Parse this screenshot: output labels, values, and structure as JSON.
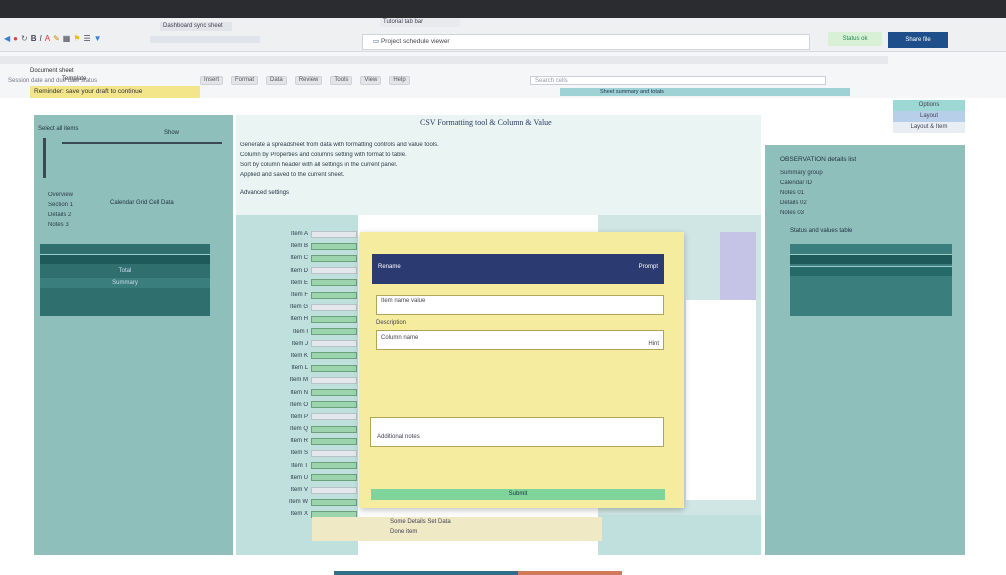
{
  "window": {
    "title": "Tutorial tab bar"
  },
  "toolbar": {
    "url_text": "Dashboard sync sheet",
    "center_text": "Project schedule viewer",
    "status_chip": "Status ok",
    "share_button": "Share file",
    "icons": [
      "back-icon",
      "forward-icon",
      "refresh-icon",
      "bold-icon",
      "italic-icon",
      "text-color-icon",
      "paint-icon",
      "table-icon",
      "link-icon",
      "comment-icon",
      "filter-icon"
    ]
  },
  "ribbon": {
    "left_labels": [
      "Document sheet",
      "Template"
    ],
    "row_text": "Session date and due date status",
    "tabs": [
      "Insert",
      "Format",
      "Data",
      "Review",
      "Tools",
      "View",
      "Help"
    ],
    "search_placeholder": "Search cells",
    "summary_text": "Sheet summary and totals"
  },
  "yellow_bar": {
    "text": "Reminder: save your draft to continue"
  },
  "top_right_menu": [
    "Options",
    "Layout",
    "Layout & Item"
  ],
  "left_panel": {
    "header": "Select all items",
    "sub_header": "Show",
    "items": [
      "Overview",
      "Section 1",
      "Details 2",
      "Notes 3"
    ],
    "details_text": "Calendar Grid Cell Data",
    "chart_labels": [
      "Total",
      "Summary"
    ]
  },
  "main": {
    "title": "CSV Formatting tool & Column & Value",
    "intro_lines": [
      "Generate a spreadsheet from data with formatting controls and value tools.",
      "Column by Properties and columns setting with format to table.",
      "Sort by column header with all settings in the current panel.",
      "Applied and saved to the current sheet."
    ],
    "section_label": "Advanced settings",
    "rows": [
      "Item A",
      "Item B",
      "Item C",
      "Item D",
      "Item E",
      "Item F",
      "Item G",
      "Item H",
      "Item I",
      "Item J",
      "Item K",
      "Item L",
      "Item M",
      "Item N",
      "Item O",
      "Item P",
      "Item Q",
      "Item R",
      "Item S",
      "Item T",
      "Item U",
      "Item V",
      "Item W",
      "Item X"
    ],
    "footer_line1": "Some Details Set Data",
    "footer_line2": "Done item"
  },
  "dialog": {
    "title": "Rename",
    "corner_label": "Prompt",
    "field1_label": "Item name value",
    "field2_label": "Description",
    "field3_label": "Column name",
    "field3_hint": "Hint",
    "field4_label": "Additional notes",
    "confirm_button": "Submit"
  },
  "right_panel": {
    "header": "OBSERVATION details list",
    "lines": [
      "Summary group",
      "Calendar ID",
      "Notes 01",
      "Details 02",
      "Notes 03"
    ],
    "summary_label": "Status and values table"
  },
  "colors": {
    "teal": "#8fbfba",
    "dark_teal": "#2f6f6e",
    "dialog": "#f6ec9f",
    "navy": "#2c3a72",
    "green": "#7ed49a"
  }
}
